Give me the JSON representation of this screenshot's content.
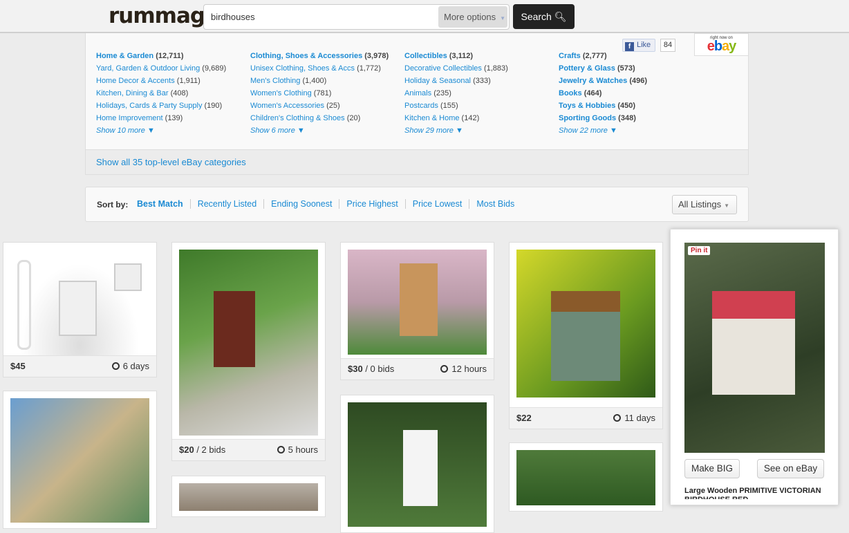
{
  "header": {
    "logo": "rummage",
    "search_value": "birdhouses",
    "more_options": "More options",
    "search_button": "Search"
  },
  "categories": {
    "columns": [
      {
        "top": {
          "label": "Home & Garden",
          "count": "(12,711)"
        },
        "items": [
          {
            "label": "Yard, Garden & Outdoor Living",
            "count": "(9,689)"
          },
          {
            "label": "Home Decor & Accents",
            "count": "(1,911)"
          },
          {
            "label": "Kitchen, Dining & Bar",
            "count": "(408)"
          },
          {
            "label": "Holidays, Cards & Party Supply",
            "count": "(190)"
          },
          {
            "label": "Home Improvement",
            "count": "(139)"
          }
        ],
        "show_more": "Show 10 more ▼"
      },
      {
        "top": {
          "label": "Clothing, Shoes & Accessories",
          "count": "(3,978)"
        },
        "items": [
          {
            "label": "Unisex Clothing, Shoes & Accs",
            "count": "(1,772)"
          },
          {
            "label": "Men's Clothing",
            "count": "(1,400)"
          },
          {
            "label": "Women's Clothing",
            "count": "(781)"
          },
          {
            "label": "Women's Accessories",
            "count": "(25)"
          },
          {
            "label": "Children's Clothing & Shoes",
            "count": "(20)"
          }
        ],
        "show_more": "Show 6 more ▼"
      },
      {
        "top": {
          "label": "Collectibles",
          "count": "(3,112)"
        },
        "items": [
          {
            "label": "Decorative Collectibles",
            "count": "(1,883)"
          },
          {
            "label": "Holiday & Seasonal",
            "count": "(333)"
          },
          {
            "label": "Animals",
            "count": "(235)"
          },
          {
            "label": "Postcards",
            "count": "(155)"
          },
          {
            "label": "Kitchen & Home",
            "count": "(142)"
          }
        ],
        "show_more": "Show 29 more ▼"
      },
      {
        "top": {
          "label": "Crafts",
          "count": "(2,777)"
        },
        "items": [
          {
            "label": "Pottery & Glass",
            "count": "(573)"
          },
          {
            "label": "Jewelry & Watches",
            "count": "(496)"
          },
          {
            "label": "Books",
            "count": "(464)"
          },
          {
            "label": "Toys & Hobbies",
            "count": "(450)"
          },
          {
            "label": "Sporting Goods",
            "count": "(348)"
          }
        ],
        "show_more": "Show 22 more ▼"
      }
    ],
    "show_all": "Show all 35 top-level eBay categories",
    "fb_like": "Like",
    "fb_count": "84",
    "ebay_badge": {
      "caption": "right now on",
      "logo": "ebay"
    }
  },
  "sort": {
    "label": "Sort by:",
    "options": [
      "Best Match",
      "Recently Listed",
      "Ending Soonest",
      "Price Highest",
      "Price Lowest",
      "Most Bids"
    ],
    "active": "Best Match",
    "listing_filter": "All Listings"
  },
  "items": [
    {
      "price": "$45",
      "bids": "",
      "time": "6 days"
    },
    {
      "price": "$20",
      "bids": " / 2 bids",
      "time": "5 hours"
    },
    {
      "price": "$30",
      "bids": " / 0 bids",
      "time": "12 hours"
    },
    {
      "price": "$22",
      "bids": "",
      "time": "11 days"
    }
  ],
  "featured": {
    "pin": "Pin it",
    "make_big": "Make BIG",
    "see_on_ebay": "See on eBay",
    "title": "Large Wooden PRIMITIVE VICTORIAN BIRDHOUSE RED"
  }
}
